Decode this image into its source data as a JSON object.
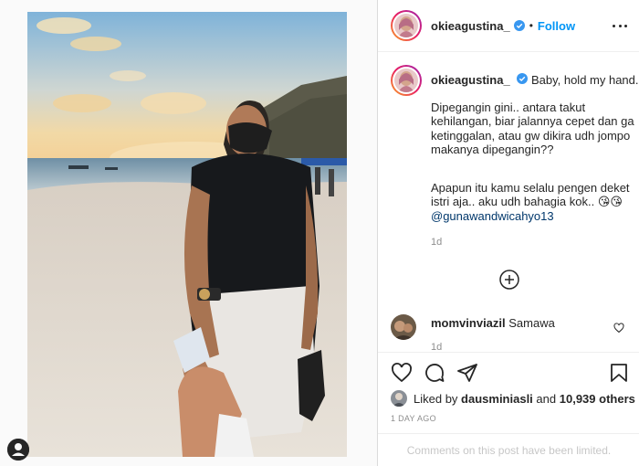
{
  "post": {
    "author": "okieagustina_",
    "follow_label": "Follow",
    "separator": "•",
    "caption_title": "Baby, hold my hand..",
    "caption_para1": "Dipegangin gini.. antara takut kehilangan, biar jalannya cepet dan ga ketinggalan, atau gw dikira udh jompo makanya dipegangin??",
    "caption_para2": "Apapun itu kamu selalu pengen deket istri aja.. aku udh bahagia kok..",
    "caption_emoji": "😘😘",
    "mention": "@gunawandwicahyo13",
    "caption_time": "1d"
  },
  "comment": {
    "user": "momvinviazil",
    "text": "Samawa",
    "time": "1d"
  },
  "likes": {
    "prefix": "Liked by",
    "user": "dausminiasli",
    "joiner": "and",
    "others": "10,939 others"
  },
  "date": "1 DAY AGO",
  "comments_limited": "Comments on this post have been limited.",
  "colors": {
    "accent": "#0095f6",
    "mention": "#00376b",
    "muted": "#8e8e8e",
    "border": "#dbdbdb"
  },
  "icons": {
    "verified": "verified-badge-icon",
    "more": "more-options-icon",
    "add": "add-circle-icon",
    "heart": "heart-icon",
    "comment": "comment-icon",
    "share": "share-icon",
    "save": "bookmark-icon"
  }
}
